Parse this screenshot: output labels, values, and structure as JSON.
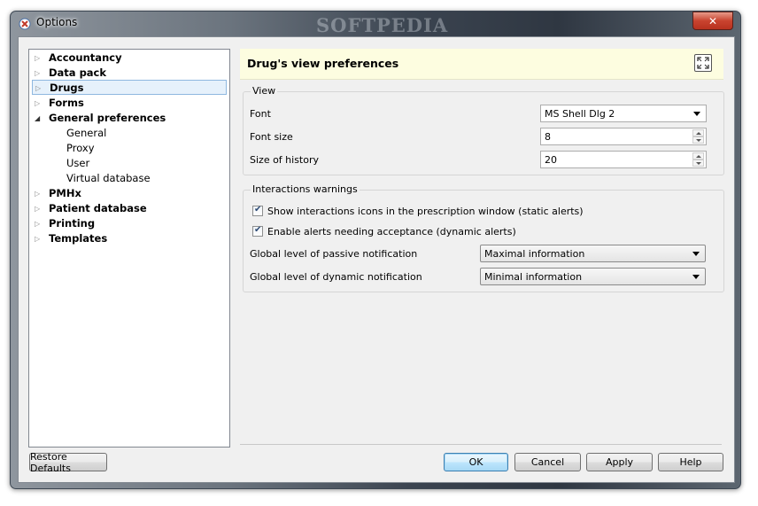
{
  "window": {
    "title": "Options",
    "watermark": "SOFTPEDIA",
    "close_glyph": "✕",
    "icon": "app-icon"
  },
  "tree": {
    "items": [
      {
        "label": "Accountancy",
        "expanded": false,
        "level": 0
      },
      {
        "label": "Data pack",
        "expanded": false,
        "level": 0
      },
      {
        "label": "Drugs",
        "expanded": false,
        "level": 0,
        "selected": true
      },
      {
        "label": "Forms",
        "expanded": false,
        "level": 0
      },
      {
        "label": "General preferences",
        "expanded": true,
        "level": 0
      },
      {
        "label": "General",
        "level": 1
      },
      {
        "label": "Proxy",
        "level": 1
      },
      {
        "label": "User",
        "level": 1
      },
      {
        "label": "Virtual database",
        "level": 1
      },
      {
        "label": "PMHx",
        "expanded": false,
        "level": 0
      },
      {
        "label": "Patient database",
        "expanded": false,
        "level": 0
      },
      {
        "label": "Printing",
        "expanded": false,
        "level": 0
      },
      {
        "label": "Templates",
        "expanded": false,
        "level": 0
      }
    ]
  },
  "panel": {
    "title": "Drug's view preferences",
    "expand_icon": "expand-icon",
    "view_group": {
      "title": "View",
      "font_label": "Font",
      "font_value": "MS Shell Dlg 2",
      "font_size_label": "Font size",
      "font_size_value": "8",
      "history_label": "Size of history",
      "history_value": "20"
    },
    "interactions_group": {
      "title": "Interactions warnings",
      "static_alerts_label": "Show interactions icons in the prescription window (static alerts)",
      "static_alerts_checked": true,
      "dynamic_alerts_label": "Enable alerts needing acceptance (dynamic alerts)",
      "dynamic_alerts_checked": true,
      "passive_label": "Global level of passive notification",
      "passive_value": "Maximal information",
      "dynamic_label": "Global level of dynamic notification",
      "dynamic_value": "Minimal information"
    }
  },
  "buttons": {
    "restore": "Restore Defaults",
    "ok": "OK",
    "cancel": "Cancel",
    "apply": "Apply",
    "help": "Help"
  },
  "colors": {
    "header_bg": "#fdfde0",
    "selection_bg": "#e6f1fb",
    "close_red": "#c9432f"
  }
}
